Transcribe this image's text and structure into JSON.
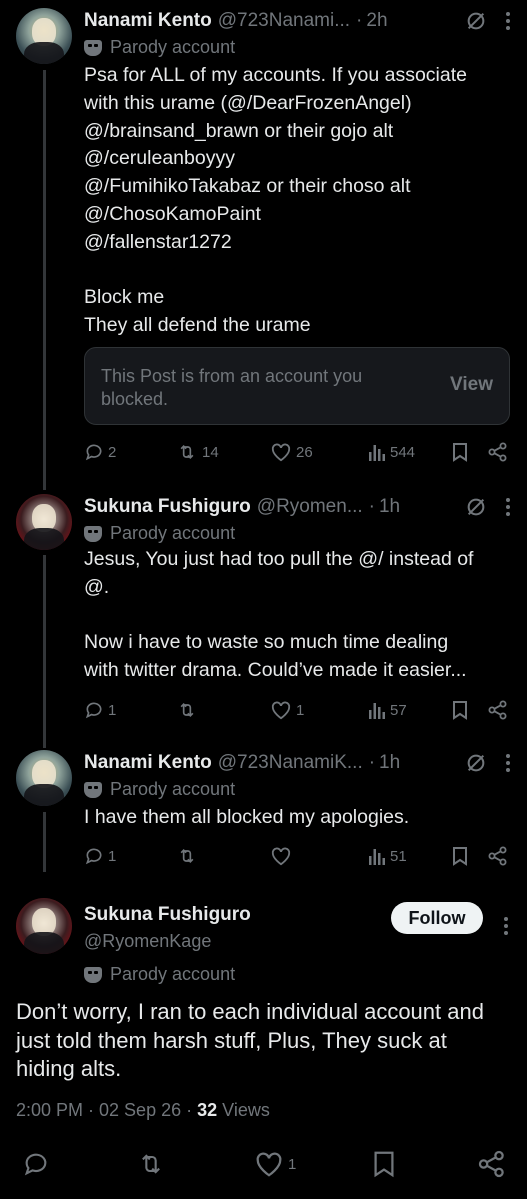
{
  "posts": [
    {
      "name": "Nanami Kento",
      "handle": "@723Nanami...",
      "time": "2h",
      "parody": "Parody account",
      "text": "Psa for ALL of my accounts. If you associate\nwith this urame (@/DearFrozenAngel)\n@/brainsand_brawn or their gojo alt\n@/ceruleanboyyy\n@/FumihikoTakabaz or their choso alt\n@/ChosoKamoPaint\n@/fallenstar1272\n\nBlock me\nThey all defend the urame",
      "notice_text": "This Post is from an account you blocked.",
      "notice_action": "View",
      "replies": "2",
      "reposts": "14",
      "likes": "26",
      "views": "544"
    },
    {
      "name": "Sukuna Fushiguro",
      "handle": "@Ryomen...",
      "time": "1h",
      "parody": "Parody account",
      "text": "Jesus, You just had too pull the @/ instead of\n@.\n\nNow i have to waste so much time dealing\nwith twitter drama. Could’ve made it easier...",
      "replies": "1",
      "reposts": "",
      "likes": "1",
      "views": "57"
    },
    {
      "name": "Nanami Kento",
      "handle": "@723NanamiK...",
      "time": "1h",
      "parody": "Parody account",
      "text": "I have them all blocked my apologies.",
      "replies": "1",
      "reposts": "",
      "likes": "",
      "views": "51"
    }
  ],
  "main": {
    "name": "Sukuna Fushiguro",
    "handle": "@RyomenKage",
    "follow_label": "Follow",
    "parody": "Parody account",
    "text": "Don’t worry, I ran to each individual account and just told them harsh stuff, Plus, They suck at hiding alts.",
    "timestamp": "2:00 PM · 02 Sep 26 · ",
    "views_count": "32",
    "views_label": " Views",
    "likes": "1"
  },
  "icons": [
    "mute-icon",
    "more-icon",
    "reply-icon",
    "repost-icon",
    "like-icon",
    "views-icon",
    "bookmark-icon",
    "share-icon",
    "parody-mask-icon"
  ]
}
